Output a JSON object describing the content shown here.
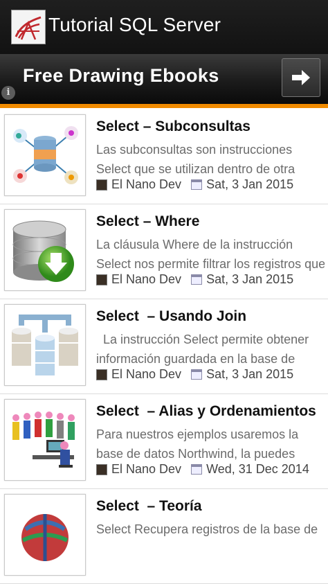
{
  "app": {
    "title": "Tutorial SQL Server"
  },
  "ad": {
    "text": "Free Drawing Ebooks",
    "info": "i"
  },
  "items": [
    {
      "title": "Select – Subconsultas",
      "line1": "Las subconsultas son instrucciones",
      "line2": "Select que se utilizan dentro de otra",
      "author": "El Nano Dev",
      "date": "Sat, 3 Jan 2015",
      "thumb": "database-network-icon"
    },
    {
      "title": "Select – Where",
      "line1": "La cláusula Where de la instrucción",
      "line2": "Select nos permite filtrar los registros que",
      "author": "El Nano Dev",
      "date": "Sat, 3 Jan 2015",
      "thumb": "database-download-icon"
    },
    {
      "title": "Select  – Usando Join",
      "line1": "  La instrucción Select permite obtener",
      "line2": "información guardada en la base de",
      "author": "El Nano Dev",
      "date": "Sat, 3 Jan 2015",
      "thumb": "database-join-icon"
    },
    {
      "title": "Select  – Alias y Ordenamientos",
      "line1": "Para nuestros ejemplos usaremos la",
      "line2": "base de datos Northwind, la puedes",
      "author": "El Nano Dev",
      "date": "Wed, 31 Dec 2014",
      "thumb": "people-computer-icon"
    },
    {
      "title": "Select  – Teoría",
      "line1": "Select Recupera registros de la base de",
      "line2": "",
      "author": "",
      "date": "",
      "thumb": "globe-icon"
    }
  ]
}
